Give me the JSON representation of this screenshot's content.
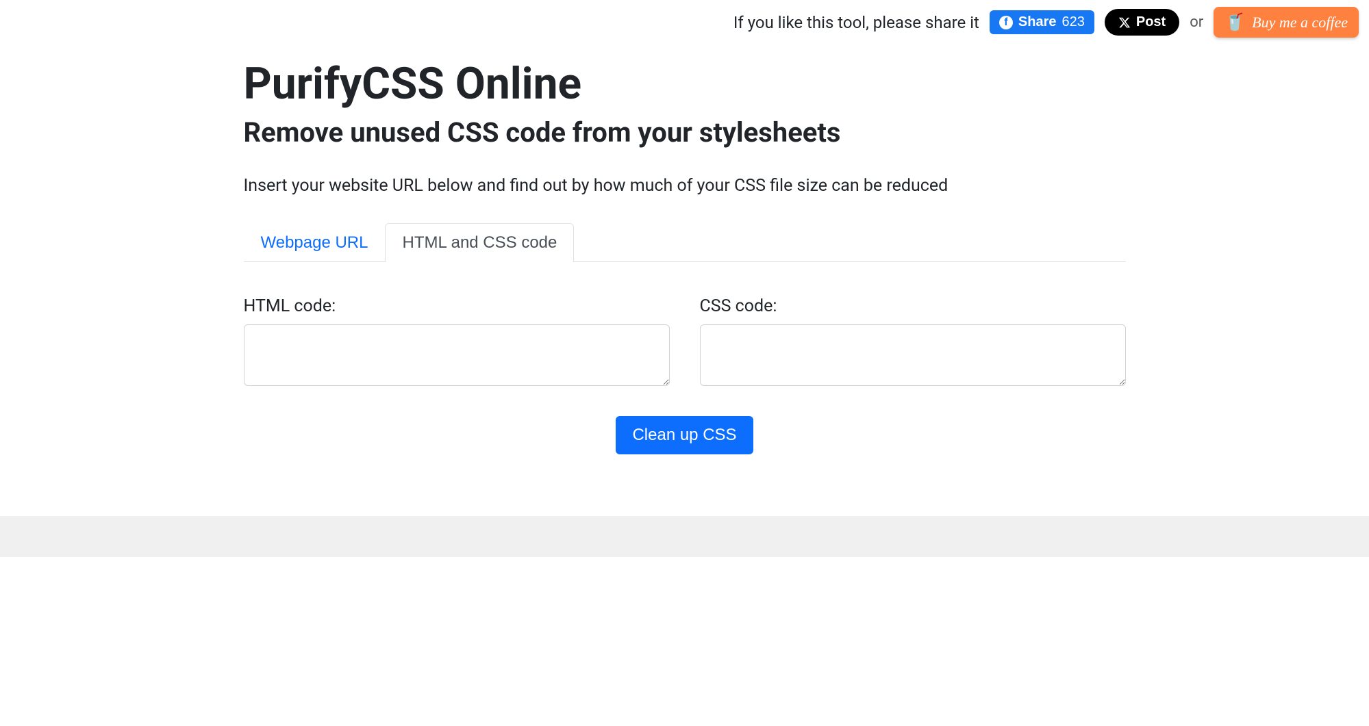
{
  "topbar": {
    "share_prompt": "If you like this tool, please share it",
    "fb_share_label": "Share",
    "fb_share_count": "623",
    "x_post_label": "Post",
    "or_text": "or",
    "bmc_label": "Buy me a coffee"
  },
  "header": {
    "title": "PurifyCSS Online",
    "subtitle": "Remove unused CSS code from your stylesheets",
    "description": "Insert your website URL below and find out by how much of your CSS file size can be reduced"
  },
  "tabs": {
    "inactive_label": "Webpage URL",
    "active_label": "HTML and CSS code"
  },
  "form": {
    "html_label": "HTML code:",
    "css_label": "CSS code:",
    "html_value": "",
    "css_value": "",
    "submit_label": "Clean up CSS"
  }
}
